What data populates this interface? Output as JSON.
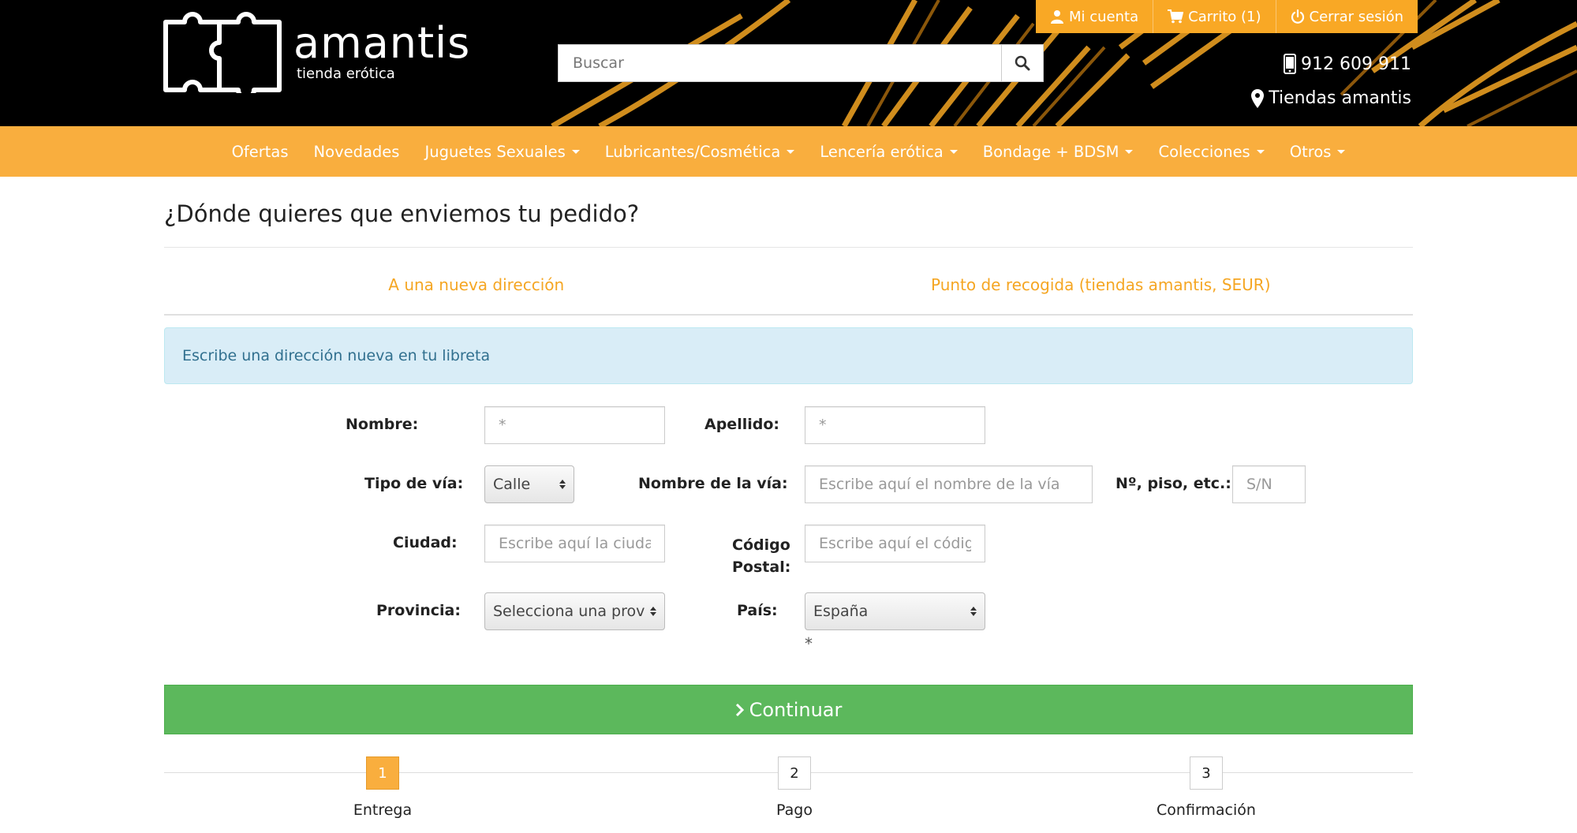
{
  "header": {
    "logo_name": "amantis",
    "logo_subtitle": "tienda erótica",
    "search_placeholder": "Buscar",
    "account_label": "Mi cuenta",
    "cart_label": "Carrito (1)",
    "logout_label": "Cerrar sesión",
    "phone": "912 609 911",
    "stores_label": "Tiendas amantis"
  },
  "nav": {
    "items": [
      {
        "label": "Ofertas",
        "dropdown": false
      },
      {
        "label": "Novedades",
        "dropdown": false
      },
      {
        "label": "Juguetes Sexuales",
        "dropdown": true
      },
      {
        "label": "Lubricantes/Cosmética",
        "dropdown": true
      },
      {
        "label": "Lencería erótica",
        "dropdown": true
      },
      {
        "label": "Bondage + BDSM",
        "dropdown": true
      },
      {
        "label": "Colecciones",
        "dropdown": true
      },
      {
        "label": "Otros",
        "dropdown": true
      }
    ]
  },
  "main": {
    "title": "¿Dónde quieres que enviemos tu pedido?",
    "tabs": [
      "A una nueva dirección",
      "Punto de recogida (tiendas amantis, SEUR)"
    ],
    "alert": "Escribe una dirección nueva en tu libreta",
    "form": {
      "nombre_label": "Nombre:",
      "nombre_placeholder": "*",
      "apellido_label": "Apellido:",
      "apellido_placeholder": "*",
      "tipo_via_label": "Tipo de vía:",
      "tipo_via_value": "Calle",
      "nombre_via_label": "Nombre de la vía:",
      "nombre_via_placeholder": "Escribe aquí el nombre de la vía",
      "numero_label": "Nº, piso, etc.:",
      "numero_placeholder": "S/N",
      "ciudad_label": "Ciudad:",
      "ciudad_placeholder": "Escribe aquí la ciudad",
      "cp_label_1": "Código",
      "cp_label_2": "Postal:",
      "cp_placeholder": "Escribe aquí el código postal",
      "provincia_label": "Provincia:",
      "provincia_value": "Selecciona una provincia",
      "pais_label": "País:",
      "pais_value": "España",
      "required_mark": "*"
    },
    "continue_label": "Continuar",
    "steps": [
      {
        "number": "1",
        "label": "Entrega",
        "active": true
      },
      {
        "number": "2",
        "label": "Pago",
        "active": false
      },
      {
        "number": "3",
        "label": "Confirmación",
        "active": false
      }
    ]
  },
  "colors": {
    "accent_orange": "#f9ae3e",
    "success_green": "#5cb85c",
    "info_blue_bg": "#d9edf7"
  }
}
